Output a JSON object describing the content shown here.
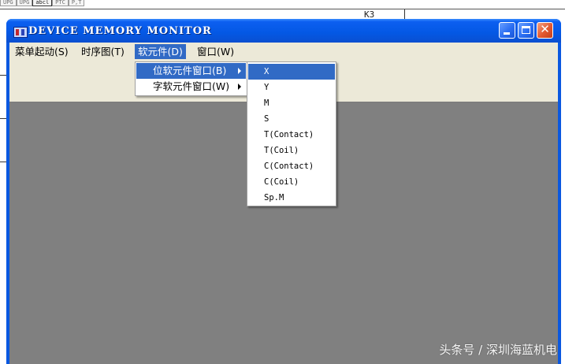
{
  "background": {
    "cell_labels": [
      "UPG",
      "UPG",
      "abcl",
      "PTC",
      "P,T"
    ],
    "k_label": "K3"
  },
  "window": {
    "title": "DEVICE MEMORY MONITOR",
    "controls": {
      "close_glyph": "✕"
    }
  },
  "menubar": {
    "items": [
      {
        "label": "菜单起动(S)"
      },
      {
        "label": "时序图(T)"
      },
      {
        "label": "软元件(D)"
      },
      {
        "label": "窗口(W)"
      }
    ]
  },
  "device_menu": {
    "items": [
      {
        "label": "位软元件窗口(B)"
      },
      {
        "label": "字软元件窗口(W)"
      }
    ]
  },
  "bit_device_submenu": {
    "items": [
      {
        "label": "X"
      },
      {
        "label": "Y"
      },
      {
        "label": "M"
      },
      {
        "label": "S"
      },
      {
        "label": "T(Contact)"
      },
      {
        "label": "T(Coil)"
      },
      {
        "label": "C(Contact)"
      },
      {
        "label": "C(Coil)"
      },
      {
        "label": "Sp.M"
      }
    ]
  },
  "watermark": "头条号 / 深圳海蓝机电"
}
